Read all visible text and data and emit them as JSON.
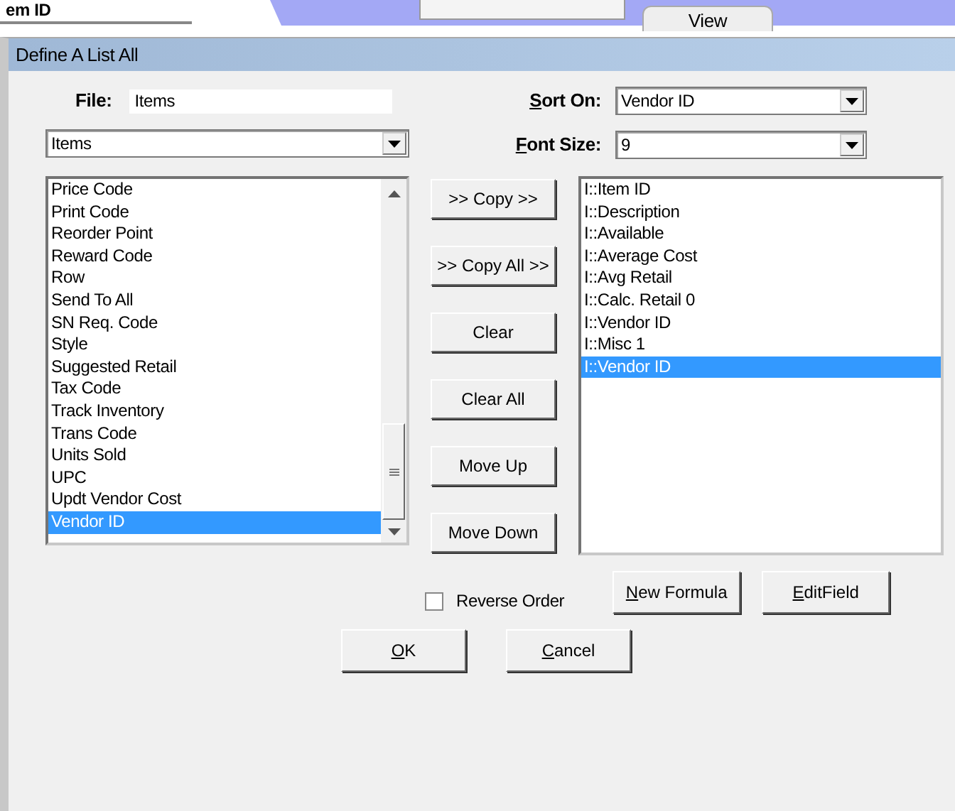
{
  "background_window": {
    "cut_text": "em ID",
    "tab": "View"
  },
  "window": {
    "title": "Define A List All"
  },
  "file": {
    "label": "File:",
    "value": "Items"
  },
  "file_combo": {
    "value": "Items"
  },
  "sort_on": {
    "label": "Sort On:",
    "underline_first": true,
    "value": "Vendor ID"
  },
  "font_size": {
    "label": "Font Size:",
    "underline_first": true,
    "value": "9"
  },
  "available_fields": [
    {
      "text": "Price Code",
      "selected": false
    },
    {
      "text": "Print Code",
      "selected": false
    },
    {
      "text": "Reorder Point",
      "selected": false
    },
    {
      "text": "Reward Code",
      "selected": false
    },
    {
      "text": "Row",
      "selected": false
    },
    {
      "text": "Send To All",
      "selected": false
    },
    {
      "text": "SN Req. Code",
      "selected": false
    },
    {
      "text": "Style",
      "selected": false
    },
    {
      "text": "Suggested Retail",
      "selected": false
    },
    {
      "text": "Tax Code",
      "selected": false
    },
    {
      "text": "Track Inventory",
      "selected": false
    },
    {
      "text": "Trans Code",
      "selected": false
    },
    {
      "text": "Units Sold",
      "selected": false
    },
    {
      "text": "UPC",
      "selected": false
    },
    {
      "text": "Updt Vendor Cost",
      "selected": false
    },
    {
      "text": "Vendor ID",
      "selected": true
    }
  ],
  "middle_buttons": [
    {
      "label": ">> Copy >>"
    },
    {
      "label": ">> Copy All >>"
    },
    {
      "label": "Clear"
    },
    {
      "label": "Clear All"
    },
    {
      "label": "Move Up"
    },
    {
      "label": "Move Down"
    }
  ],
  "selected_fields": [
    {
      "text": "I::Item ID",
      "selected": false
    },
    {
      "text": "I::Description",
      "selected": false
    },
    {
      "text": "I::Available",
      "selected": false
    },
    {
      "text": "I::Average Cost",
      "selected": false
    },
    {
      "text": "I::Avg Retail",
      "selected": false
    },
    {
      "text": "I::Calc. Retail 0",
      "selected": false
    },
    {
      "text": "I::Vendor ID",
      "selected": false
    },
    {
      "text": "I::Misc 1",
      "selected": false
    },
    {
      "text": "I::Vendor ID",
      "selected": true
    }
  ],
  "reverse_order": {
    "label": "Reverse Order",
    "checked": false
  },
  "formula_buttons": [
    {
      "label": "New Formula",
      "underline_first": true
    },
    {
      "label": "EditField",
      "underline_first": true
    }
  ],
  "dialog_buttons": [
    {
      "label": "OK",
      "underline_first": true
    },
    {
      "label": "Cancel",
      "underline_first": true
    }
  ]
}
